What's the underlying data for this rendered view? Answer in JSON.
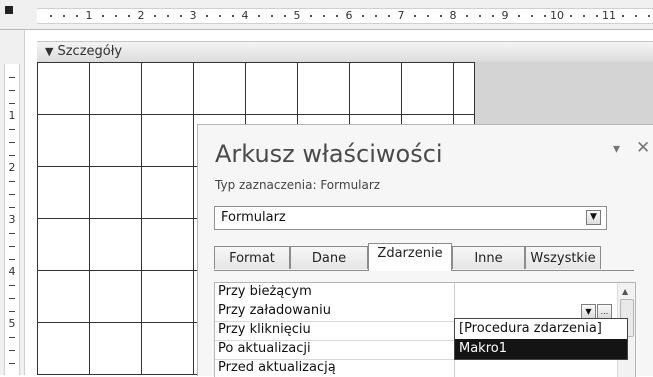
{
  "ruler": {
    "h_labels": [
      "1",
      "2",
      "3",
      "4",
      "5",
      "6",
      "7",
      "8",
      "9",
      "10",
      "11"
    ],
    "v_labels": [
      "1",
      "2",
      "3",
      "4",
      "5"
    ]
  },
  "section": {
    "icon": "section-arrow-icon",
    "label": "Szczegóły"
  },
  "property_sheet": {
    "title": "Arkusz właściwości",
    "selection_type": "Typ zaznaczenia:  Formularz",
    "selector_value": "Formularz",
    "tabs": [
      {
        "label": "Format",
        "active": false
      },
      {
        "label": "Dane",
        "active": false
      },
      {
        "label": "Zdarzenie",
        "active": true
      },
      {
        "label": "Inne",
        "active": false
      },
      {
        "label": "Wszystkie",
        "active": false
      }
    ],
    "properties": [
      {
        "name": "Przy bieżącym",
        "value": ""
      },
      {
        "name": "Przy załadowaniu",
        "value": ""
      },
      {
        "name": "Przy kliknięciu",
        "value": ""
      },
      {
        "name": "Po aktualizacji",
        "value": ""
      },
      {
        "name": "Przed aktualizacją",
        "value": ""
      }
    ],
    "builder_button_label": "...",
    "dropdown_options": [
      "[Procedura zdarzenia]",
      "Makro1"
    ],
    "dropdown_selected": "Makro1"
  },
  "colors": {
    "selected_item_bg": "#141414",
    "grid_line": "#333333",
    "outside_area": "#d4d4d4"
  }
}
